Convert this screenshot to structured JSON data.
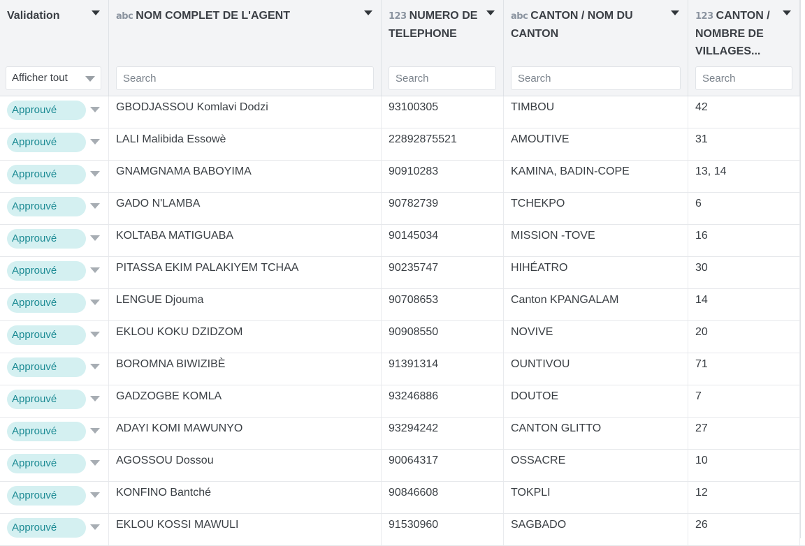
{
  "columns": [
    {
      "key": "validation",
      "type_label": "",
      "title": "Validation"
    },
    {
      "key": "nom",
      "type_label": "abc",
      "title": "NOM COMPLET DE L'AGENT"
    },
    {
      "key": "tel",
      "type_label": "123",
      "title": "NUMERO DE TELEPHONE"
    },
    {
      "key": "canton",
      "type_label": "abc",
      "title": "CANTON / NOM DU CANTON"
    },
    {
      "key": "villages",
      "type_label": "123",
      "title": "CANTON / NOMBRE DE VILLAGES..."
    }
  ],
  "filters": {
    "validation_value": "Afficher tout",
    "search_placeholder": "Search"
  },
  "rows": [
    {
      "status": "Approuvé",
      "nom": "GBODJASSOU Komlavi Dodzi",
      "tel": "93100305",
      "canton": "TIMBOU",
      "villages": "42"
    },
    {
      "status": "Approuvé",
      "nom": "LALI Malibida Essowè",
      "tel": "22892875521",
      "canton": "AMOUTIVE",
      "villages": "31"
    },
    {
      "status": "Approuvé",
      "nom": "GNAMGNAMA BABOYIMA",
      "tel": "90910283",
      "canton": "KAMINA, BADIN-COPE",
      "villages": "13, 14"
    },
    {
      "status": "Approuvé",
      "nom": "GADO N'LAMBA",
      "tel": "90782739",
      "canton": "TCHEKPO",
      "villages": "6"
    },
    {
      "status": "Approuvé",
      "nom": "KOLTABA MATIGUABA",
      "tel": "90145034",
      "canton": "MISSION -TOVE",
      "villages": "16"
    },
    {
      "status": "Approuvé",
      "nom": "PITASSA EKIM PALAKIYEM TCHAA",
      "tel": "90235747",
      "canton": "HIHÉATRO",
      "villages": "30"
    },
    {
      "status": "Approuvé",
      "nom": "LENGUE Djouma",
      "tel": "90708653",
      "canton": "Canton KPANGALAM",
      "villages": "14"
    },
    {
      "status": "Approuvé",
      "nom": "EKLOU KOKU DZIDZOM",
      "tel": "90908550",
      "canton": "NOVIVE",
      "villages": "20"
    },
    {
      "status": "Approuvé",
      "nom": "BOROMNA BIWIZIBÈ",
      "tel": "91391314",
      "canton": "OUNTIVOU",
      "villages": "71"
    },
    {
      "status": "Approuvé",
      "nom": "GADZOGBE KOMLA",
      "tel": "93246886",
      "canton": "DOUTOE",
      "villages": "7"
    },
    {
      "status": "Approuvé",
      "nom": "ADAYI KOMI MAWUNYO",
      "tel": "93294242",
      "canton": "CANTON GLITTO",
      "villages": "27"
    },
    {
      "status": "Approuvé",
      "nom": "AGOSSOU Dossou",
      "tel": "90064317",
      "canton": "OSSACRE",
      "villages": "10"
    },
    {
      "status": "Approuvé",
      "nom": "KONFINO Bantché",
      "tel": "90846608",
      "canton": "TOKPLI",
      "villages": "12"
    },
    {
      "status": "Approuvé",
      "nom": "EKLOU KOSSI MAWULI",
      "tel": "91530960",
      "canton": "SAGBADO",
      "villages": "26"
    }
  ],
  "colors": {
    "status_bg": "#d4f0f1",
    "status_text": "#1b8a93",
    "header_bg": "#f3f4f6"
  },
  "icons": {
    "row_link": "external-link-icon",
    "column_menu": "caret-down-icon"
  }
}
